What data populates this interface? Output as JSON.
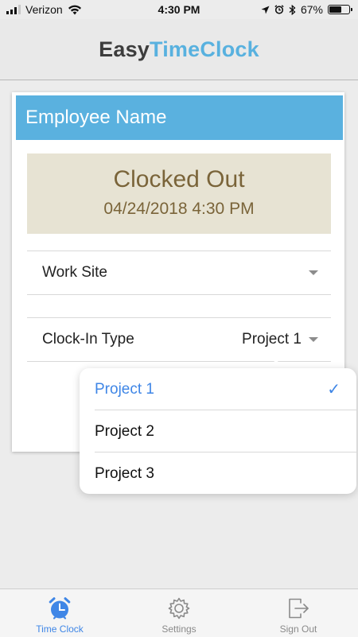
{
  "status_bar": {
    "carrier": "Verizon",
    "time": "4:30 PM",
    "battery_percent": "67%",
    "battery_level": 0.67
  },
  "header": {
    "logo_part1": "Easy",
    "logo_part2": "TimeClock",
    "logo_color_dark": "#3d3d3d",
    "logo_color_accent": "#58b1df"
  },
  "card": {
    "title": "Employee Name",
    "status_label": "Clocked Out",
    "status_datetime": "04/24/2018 4:30 PM",
    "work_site_label": "Work Site",
    "clock_in_type_label": "Clock-In Type",
    "clock_in_type_value": "Project 1"
  },
  "dropdown": {
    "options": [
      {
        "label": "Project 1",
        "selected": true
      },
      {
        "label": "Project 2",
        "selected": false
      },
      {
        "label": "Project 3",
        "selected": false
      }
    ]
  },
  "tab_bar": {
    "tabs": [
      {
        "label": "Time Clock",
        "icon": "alarm-clock-icon",
        "active": true
      },
      {
        "label": "Settings",
        "icon": "gear-icon",
        "active": false
      },
      {
        "label": "Sign Out",
        "icon": "sign-out-icon",
        "active": false
      }
    ],
    "active_color": "#3f86e6"
  }
}
